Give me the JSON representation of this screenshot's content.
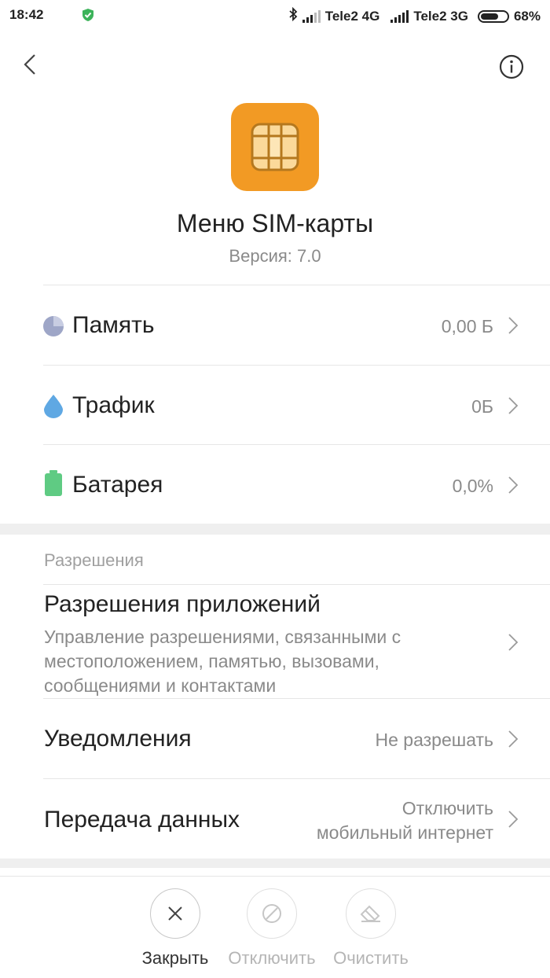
{
  "status_bar": {
    "time": "18:42",
    "carrier1": "Tele2 4G",
    "carrier2": "Tele2 3G",
    "battery": "68%",
    "icons": [
      "shield-icon",
      "bluetooth-icon",
      "signal-icon",
      "battery-icon"
    ]
  },
  "header": {
    "back_icon": "chevron-left-icon",
    "info_icon": "info-icon"
  },
  "app": {
    "name": "Меню SIM-карты",
    "version": "Версия: 7.0",
    "icon": "sim-card-icon",
    "icon_color": "#f29a24"
  },
  "usage": [
    {
      "label": "Память",
      "value": "0,00 Б",
      "icon": "storage-pie-icon",
      "icon_color": "#9ea6c7"
    },
    {
      "label": "Трафик",
      "value": "0Б",
      "icon": "water-drop-icon",
      "icon_color": "#5fa8e3"
    },
    {
      "label": "Батарея",
      "value": "0,0%",
      "icon": "battery-icon",
      "icon_color": "#5fcb83"
    }
  ],
  "permissions": {
    "section_title": "Разрешения",
    "app_permissions_title": "Разрешения приложений",
    "app_permissions_desc": "Управление разрешениями, связанными с местоположением, памятью, вызовами, сообщениями и контактами",
    "notifications_label": "Уведомления",
    "notifications_value": "Не разрешать",
    "data_label": "Передача данных",
    "data_value_line1": "Отключить",
    "data_value_line2": "мобильный интернет"
  },
  "actions": [
    {
      "label": "Закрыть",
      "icon": "close-icon",
      "enabled": true
    },
    {
      "label": "Отключить",
      "icon": "disable-icon",
      "enabled": false
    },
    {
      "label": "Очистить",
      "icon": "eraser-icon",
      "enabled": false
    }
  ]
}
